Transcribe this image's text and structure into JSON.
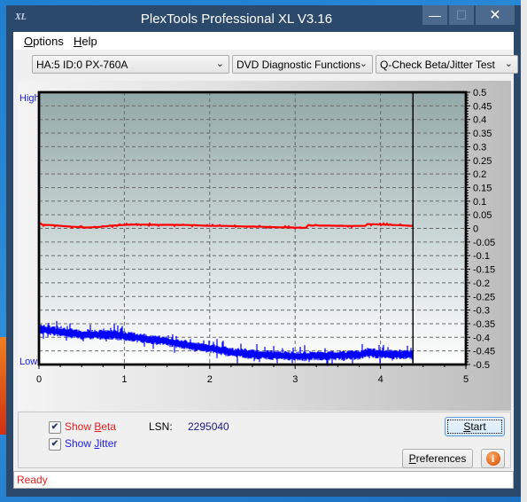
{
  "window": {
    "title": "PlexTools Professional XL V3.16",
    "app_icon_label": "XL",
    "minimize_glyph": "—",
    "maximize_glyph": "☐",
    "close_glyph": "✕"
  },
  "menu": {
    "items": [
      {
        "label": "Options",
        "accel": "O",
        "rest": "ptions"
      },
      {
        "label": "Help",
        "accel": "H",
        "rest": "elp"
      }
    ]
  },
  "toolbar": {
    "device": "HA:5 ID:0  PX-760A",
    "function_group": "DVD Diagnostic Functions",
    "test": "Q-Check Beta/Jitter Test",
    "chevron": "⌄"
  },
  "graph": {
    "high_label": "High",
    "low_label": "Low"
  },
  "chart_data": {
    "type": "line",
    "title": "",
    "xlabel": "",
    "ylabel": "",
    "x_range": [
      0,
      5
    ],
    "x_ticks": [
      "0",
      "1",
      "2",
      "3",
      "4",
      "5"
    ],
    "y_range": [
      -0.5,
      0.5
    ],
    "y_ticks": [
      "0.5",
      "0.45",
      "0.4",
      "0.35",
      "0.3",
      "0.25",
      "0.2",
      "0.15",
      "0.1",
      "0.05",
      "0",
      "-0.05",
      "-0.1",
      "-0.15",
      "-0.2",
      "-0.25",
      "-0.3",
      "-0.35",
      "-0.4",
      "-0.45",
      "-0.5"
    ],
    "grid": true,
    "end_marker_x": 4.38,
    "colors": {
      "beta": "#ff0000",
      "jitter": "#0000ff",
      "plot_top": "#93a8a8",
      "plot_bottom": "#ffffff"
    },
    "series": [
      {
        "name": "Beta",
        "color": "#ff0000",
        "x": [
          0,
          0.05,
          0.15,
          0.3,
          0.45,
          0.55,
          0.7,
          0.85,
          1.0,
          1.2,
          1.4,
          1.6,
          1.8,
          2.0,
          2.2,
          2.4,
          2.6,
          2.8,
          3.0,
          3.12,
          3.15,
          3.4,
          3.6,
          3.82,
          3.85,
          4.0,
          4.2,
          4.38
        ],
        "values": [
          0.018,
          0.013,
          0.012,
          0.008,
          0.005,
          0.003,
          0.005,
          0.01,
          0.013,
          0.014,
          0.013,
          0.013,
          0.012,
          0.009,
          0.009,
          0.007,
          0.006,
          0.004,
          0.003,
          0.002,
          0.01,
          0.01,
          0.009,
          0.009,
          0.016,
          0.014,
          0.012,
          0.009
        ]
      },
      {
        "name": "Jitter",
        "color": "#0000ff",
        "x": [
          0,
          0.25,
          0.5,
          0.75,
          1.0,
          1.25,
          1.5,
          1.75,
          2.0,
          2.25,
          2.5,
          2.75,
          3.0,
          3.25,
          3.5,
          3.75,
          3.85,
          4.0,
          4.2,
          4.38
        ],
        "values": [
          -0.37,
          -0.38,
          -0.39,
          -0.39,
          -0.395,
          -0.405,
          -0.415,
          -0.43,
          -0.44,
          -0.455,
          -0.462,
          -0.466,
          -0.47,
          -0.468,
          -0.467,
          -0.465,
          -0.455,
          -0.462,
          -0.463,
          -0.464
        ],
        "noise_band": 0.03
      }
    ]
  },
  "controls": {
    "show_beta": {
      "label": "Show Beta",
      "accel": "B",
      "pre": "Show ",
      "post": "eta",
      "checked": true,
      "color": "#e02020"
    },
    "show_jitter": {
      "label": "Show Jitter",
      "accel": "J",
      "pre": "Show ",
      "post": "itter",
      "checked": true,
      "color": "#2020e0"
    },
    "lsn_label": "LSN:",
    "lsn_value": "2295040",
    "check_glyph": "✔",
    "start": {
      "label": "Start",
      "accel": "S",
      "rest": "tart"
    },
    "preferences": {
      "label": "Preferences",
      "accel": "P",
      "rest": "references"
    },
    "info_glyph": "i"
  },
  "status": {
    "text": "Ready"
  }
}
